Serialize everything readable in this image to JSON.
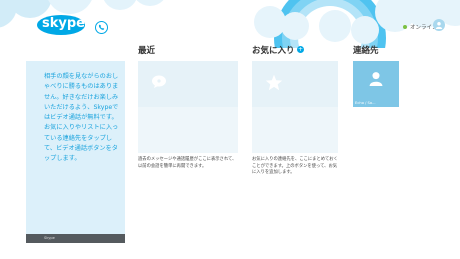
{
  "header": {
    "logo_text": "skype",
    "status_label": "オンライン"
  },
  "promo": {
    "text": "相手の顔を見ながらのおしゃべりに勝るものはありません。好きなだけお楽しみいただけるよう、Skypeではビデオ通話が無料です。お気に入りやリストに入っている連絡先をタップして、ビデオ通話ボタンをタップします。",
    "footer": "Skype"
  },
  "sections": {
    "recent": {
      "title": "最近",
      "desc": "過去のメッセージや通話履歴がここに表示されて、以前の会話を簡単に再開できます。"
    },
    "favorites": {
      "title": "お気に入り",
      "desc": "お気に入りの連絡先を、ここにまとめておくことができます。上のボタンを使って、お気に入りを追加します。"
    },
    "contacts": {
      "title": "連絡先",
      "contact_name": "Echo / So..."
    }
  },
  "colors": {
    "accent": "#00a8e6",
    "tile_bg": "#e6f2f8",
    "promo_text": "#1aa3dd"
  }
}
